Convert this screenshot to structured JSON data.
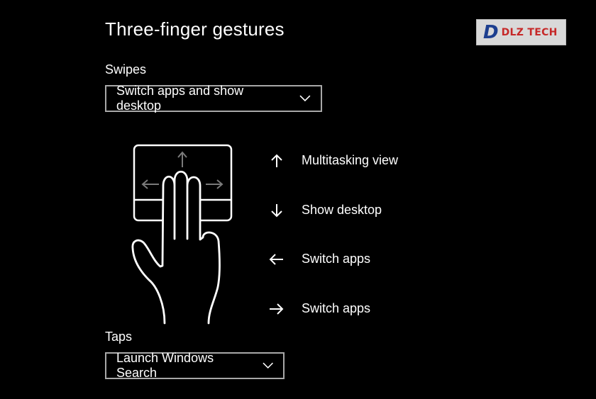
{
  "header": {
    "title": "Three-finger gestures"
  },
  "logo": {
    "text": "DLZ TECH",
    "brand_color": "#1d3f8f",
    "accent_color": "#c62828"
  },
  "swipes": {
    "label": "Swipes",
    "selected": "Switch apps and show desktop",
    "gestures": [
      {
        "icon": "arrow-up-icon",
        "label": "Multitasking view"
      },
      {
        "icon": "arrow-down-icon",
        "label": "Show desktop"
      },
      {
        "icon": "arrow-left-icon",
        "label": "Switch apps"
      },
      {
        "icon": "arrow-right-icon",
        "label": "Switch apps"
      }
    ]
  },
  "taps": {
    "label": "Taps",
    "selected": "Launch Windows Search"
  },
  "colors": {
    "background": "#000000",
    "text": "#ffffff",
    "border": "#a8a8a8"
  }
}
